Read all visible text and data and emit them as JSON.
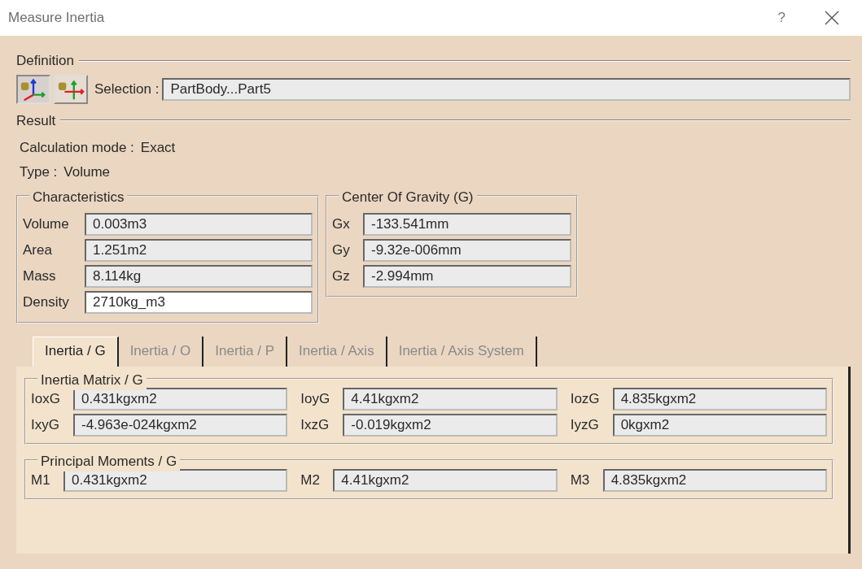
{
  "window": {
    "title": "Measure Inertia",
    "help": "?"
  },
  "definition": {
    "title": "Definition",
    "mode_buttons": [
      {
        "selected": true
      },
      {
        "selected": false
      }
    ],
    "selection_label": "Selection :",
    "selection_value": "PartBody...Part5"
  },
  "result": {
    "title": "Result",
    "calculation_mode_label": "Calculation mode :",
    "calculation_mode": "Exact",
    "type_label": "Type :",
    "type": "Volume"
  },
  "characteristics": {
    "title": "Characteristics",
    "rows": [
      {
        "label": "Volume",
        "value": "0.003m3",
        "editable": false
      },
      {
        "label": "Area",
        "value": "1.251m2",
        "editable": false
      },
      {
        "label": "Mass",
        "value": "8.114kg",
        "editable": false
      },
      {
        "label": "Density",
        "value": "2710kg_m3",
        "editable": true
      }
    ]
  },
  "center_of_gravity": {
    "title": "Center Of Gravity (G)",
    "rows": [
      {
        "label": "Gx",
        "value": "-133.541mm"
      },
      {
        "label": "Gy",
        "value": "-9.32e-006mm"
      },
      {
        "label": "Gz",
        "value": "-2.994mm"
      }
    ]
  },
  "tabs": [
    {
      "label": "Inertia / G",
      "selected": true
    },
    {
      "label": "Inertia / O",
      "selected": false
    },
    {
      "label": "Inertia / P",
      "selected": false
    },
    {
      "label": "Inertia / Axis",
      "selected": false
    },
    {
      "label": "Inertia / Axis System",
      "selected": false
    }
  ],
  "inertia_matrix": {
    "title": "Inertia Matrix / G",
    "rows": [
      [
        {
          "label": "IoxG",
          "value": "0.431kgxm2"
        },
        {
          "label": "IoyG",
          "value": "4.41kgxm2"
        },
        {
          "label": "IozG",
          "value": "4.835kgxm2"
        }
      ],
      [
        {
          "label": "IxyG",
          "value": "-4.963e-024kgxm2"
        },
        {
          "label": "IxzG",
          "value": "-0.019kgxm2"
        },
        {
          "label": "IyzG",
          "value": "0kgxm2"
        }
      ]
    ]
  },
  "principal_moments": {
    "title": "Principal Moments / G",
    "values": [
      {
        "label": "M1",
        "value": "0.431kgxm2"
      },
      {
        "label": "M2",
        "value": "4.41kgxm2"
      },
      {
        "label": "M3",
        "value": "4.835kgxm2"
      }
    ]
  }
}
